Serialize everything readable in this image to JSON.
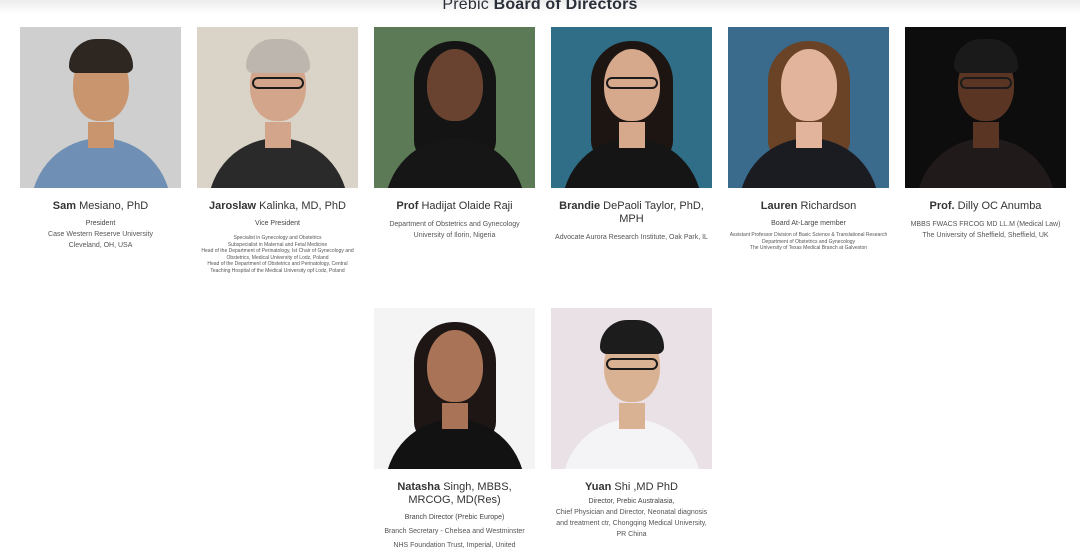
{
  "heading": {
    "prefix": "Prebic",
    "emphasis": "Board of Directors"
  },
  "directors": [
    {
      "first": "Sam",
      "rest": "Mesiano, PhD",
      "role": "President",
      "lines": [
        "Case Western Reserve University",
        "Cleveland, OH, USA"
      ],
      "colors": {
        "bg": "#cfcfcf",
        "skin": "#c9956e",
        "hair": "#2e2620",
        "shirt": "#6f8fb5"
      }
    },
    {
      "first": "Jaroslaw",
      "rest": "Kalinka, MD, PhD",
      "role": "Vice President",
      "lines": [
        "Specialist in Gynecology and Obstetrics",
        "Subspecialist in Maternal and Fetal Medicine",
        "Head of the Department of Perinatology, Ist Chair of Gynecology and Obstetrics, Medical University of Lodz, Poland",
        "Head of the Department of Obstetrics and Perinatology, Central Teaching Hospital of the Medical University opf Lodz, Poland"
      ],
      "colors": {
        "bg": "#d9d3c8",
        "skin": "#d3a58a",
        "hair": "#bdb6ae",
        "shirt": "#2a2a2a"
      }
    },
    {
      "first": "Prof",
      "rest": "Hadijat Olaide Raji",
      "role": "",
      "lines": [
        "Department of Obstetrics and Gynecology",
        "University of Ilorin, Nigeria"
      ],
      "colors": {
        "bg": "#5d7a56",
        "skin": "#6a4330",
        "hair": "#141414",
        "shirt": "#161616"
      }
    },
    {
      "first": "Brandie",
      "rest": "DePaoli Taylor, PhD, MPH",
      "role": "",
      "lines": [
        "Advocate Aurora Research Institute, Oak Park, IL"
      ],
      "colors": {
        "bg": "#2f6e86",
        "skin": "#d6a88c",
        "hair": "#1c1512",
        "shirt": "#151515"
      }
    },
    {
      "first": "Lauren",
      "rest": "Richardson",
      "role": "Board At-Large member",
      "lines": [
        "Assistant Professor Division of Basic Science & Translational Research",
        "Department of Obstetrics and Gynecology",
        "The University of Texas Medical Branch at Galveston"
      ],
      "colors": {
        "bg": "#3a6a8c",
        "skin": "#e1b49b",
        "hair": "#6a4327",
        "shirt": "#1a1c22"
      }
    },
    {
      "first": "Prof.",
      "rest": "Dilly OC Anumba",
      "role": "",
      "lines": [
        "MBBS FWACS FRCOG MD LL.M (Medical Law)",
        "The University of Sheffield, Sheffield, UK"
      ],
      "colors": {
        "bg": "#0d0d0d",
        "skin": "#5a3524",
        "hair": "#1a1a1a",
        "shirt": "#201a1a"
      }
    },
    {
      "first": "Natasha",
      "rest": "Singh, MBBS, MRCOG, MD(Res)",
      "role": "Branch Director (Prebic Europe)",
      "lines": [
        "Branch Secretary - Chelsea and Westminster",
        "NHS Foundation Trust, Imperial, United"
      ],
      "colors": {
        "bg": "#f4f4f4",
        "skin": "#a87356",
        "hair": "#1d1614",
        "shirt": "#121212"
      }
    },
    {
      "first": "Yuan",
      "rest": "Shi ,MD PhD",
      "role": "Director, Prebic Australasia,",
      "lines": [
        "Chief Physician and Director, Neonatal diagnosis and treatment ctr, Chongqing Medical University, PR China"
      ],
      "colors": {
        "bg": "#e9e1e6",
        "skin": "#d9b293",
        "hair": "#1c1c1c",
        "shirt": "#f4f4f6"
      }
    }
  ]
}
